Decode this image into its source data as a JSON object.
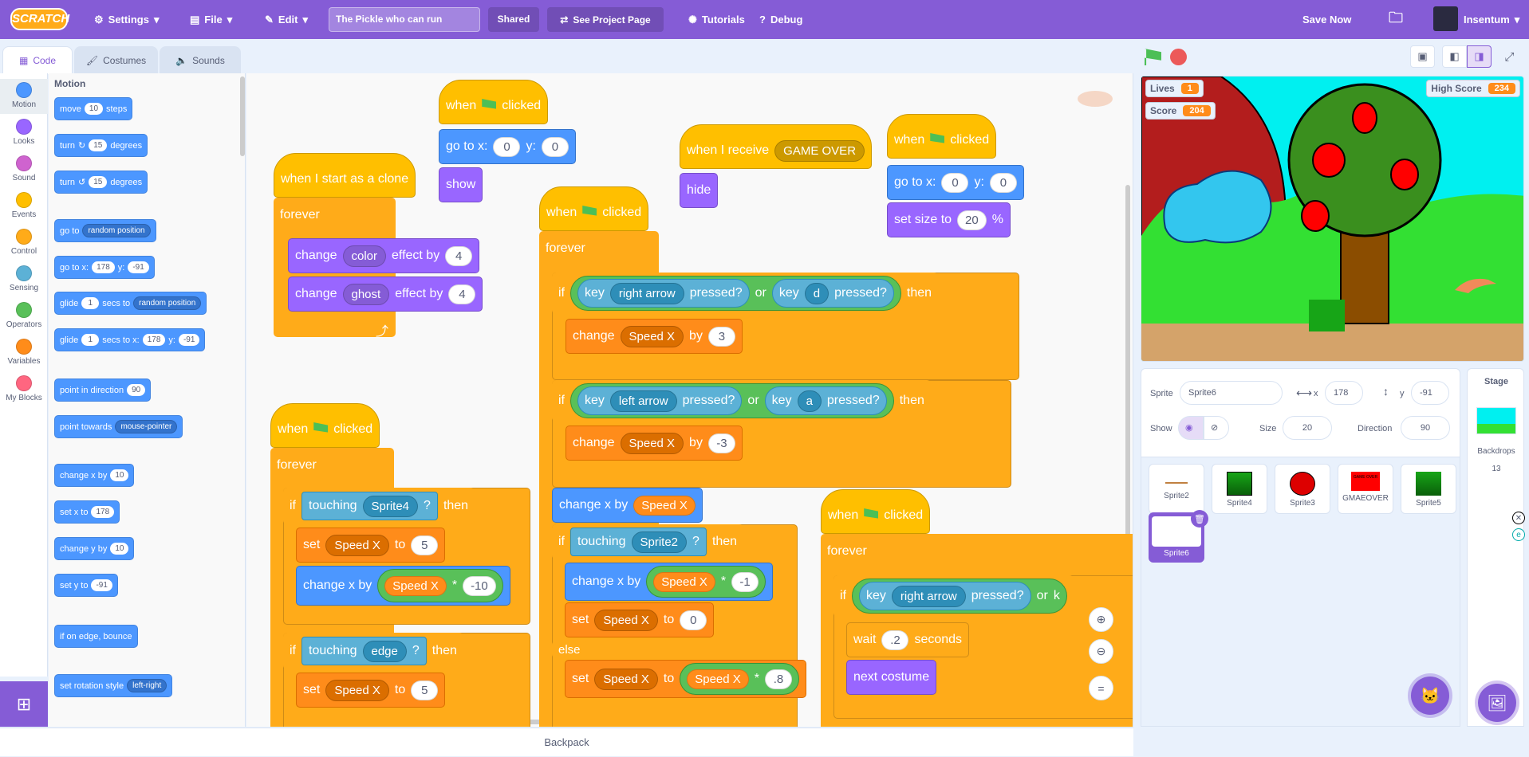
{
  "menubar": {
    "logo": "SCRATCH",
    "settings": "Settings",
    "file": "File",
    "edit": "Edit",
    "project_title": "The Pickle who can run",
    "shared": "Shared",
    "see_project_page": "See Project Page",
    "tutorials": "Tutorials",
    "debug": "Debug",
    "save_now": "Save Now",
    "username": "Insentum"
  },
  "tabs": {
    "code": "Code",
    "costumes": "Costumes",
    "sounds": "Sounds"
  },
  "categories": [
    {
      "label": "Motion",
      "color": "#4c97ff"
    },
    {
      "label": "Looks",
      "color": "#9966ff"
    },
    {
      "label": "Sound",
      "color": "#cf63cf"
    },
    {
      "label": "Events",
      "color": "#ffbf00"
    },
    {
      "label": "Control",
      "color": "#ffab19"
    },
    {
      "label": "Sensing",
      "color": "#5cb1d6"
    },
    {
      "label": "Operators",
      "color": "#59c059"
    },
    {
      "label": "Variables",
      "color": "#ff8c1a"
    },
    {
      "label": "My Blocks",
      "color": "#ff6680"
    }
  ],
  "palette": {
    "heading": "Motion",
    "move": {
      "a": "move",
      "n": "10",
      "b": "steps"
    },
    "turn_right": {
      "a": "turn",
      "n": "15",
      "b": "degrees"
    },
    "turn_left": {
      "a": "turn",
      "n": "15",
      "b": "degrees"
    },
    "goto": {
      "a": "go to",
      "dd": "random position"
    },
    "goto_xy": {
      "a": "go to x:",
      "x": "178",
      "b": "y:",
      "y": "-91"
    },
    "glide": {
      "a": "glide",
      "n": "1",
      "b": "secs to",
      "dd": "random position"
    },
    "glide_xy": {
      "a": "glide",
      "n": "1",
      "b": "secs to x:",
      "x": "178",
      "c": "y:",
      "y": "-91"
    },
    "point_dir": {
      "a": "point in direction",
      "n": "90"
    },
    "point_towards": {
      "a": "point towards",
      "dd": "mouse-pointer"
    },
    "change_x": {
      "a": "change x by",
      "n": "10"
    },
    "set_x": {
      "a": "set x to",
      "n": "178"
    },
    "change_y": {
      "a": "change y by",
      "n": "10"
    },
    "set_y": {
      "a": "set y to",
      "n": "-91"
    },
    "bounce": {
      "a": "if on edge, bounce"
    },
    "rot_style": {
      "a": "set rotation style",
      "dd": "left-right"
    }
  },
  "script1": {
    "hat": "when I start as a clone",
    "forever": "forever",
    "change": "change",
    "color": "color",
    "effect_by": "effect by",
    "v1": "4",
    "ghost": "ghost",
    "v2": "4"
  },
  "script2": {
    "when": "when",
    "clicked": "clicked",
    "goto": "go to x:",
    "x": "0",
    "y_lbl": "y:",
    "y": "0",
    "show": "show"
  },
  "script3": {
    "hat": "when I receive",
    "msg": "GAME OVER",
    "hide": "hide"
  },
  "script4": {
    "when": "when",
    "clicked": "clicked",
    "goto": "go to x:",
    "x": "0",
    "y_lbl": "y:",
    "y": "0",
    "set_size": "set size to",
    "size": "20",
    "pct": "%"
  },
  "script5": {
    "when": "when",
    "clicked": "clicked",
    "forever": "forever",
    "if": "if",
    "then": "then",
    "key": "key",
    "pressed": "pressed?",
    "or": "or",
    "right_arrow": "right arrow",
    "d": "d",
    "left_arrow": "left arrow",
    "a": "a",
    "change": "change",
    "speedx": "Speed X",
    "by": "by",
    "v3": "3",
    "vm3": "-3",
    "change_x_by": "change x by",
    "touching": "touching",
    "sprite2": "Sprite2",
    "q": "?",
    "m1": "-1",
    "star": "*",
    "set": "set",
    "to": "to",
    "zero": "0",
    "else": "else",
    "p8": ".8"
  },
  "script6": {
    "when": "when",
    "clicked": "clicked",
    "forever": "forever",
    "if": "if",
    "then": "then",
    "touching": "touching",
    "sprite4": "Sprite4",
    "q": "?",
    "set": "set",
    "speedx": "Speed X",
    "to": "to",
    "five": "5",
    "change_x_by": "change x by",
    "star": "*",
    "m10": "-10",
    "edge": "edge",
    "five2": "5"
  },
  "script7": {
    "when": "when",
    "clicked": "clicked",
    "forever": "forever",
    "if": "if",
    "key": "key",
    "right_arrow": "right arrow",
    "pressed": "pressed?",
    "or": "or",
    "k": "k",
    "wait": "wait",
    "secs": ".2",
    "seconds": "seconds",
    "next_costume": "next costume"
  },
  "backpack": "Backpack",
  "monitors": {
    "lives_label": "Lives",
    "lives": "1",
    "score_label": "Score",
    "score": "204",
    "high_label": "High Score",
    "high": "234"
  },
  "sprite_info": {
    "sprite_label": "Sprite",
    "sprite_name": "Sprite6",
    "x_label": "x",
    "x": "178",
    "y_label": "y",
    "y": "-91",
    "show_label": "Show",
    "size_label": "Size",
    "size": "20",
    "direction_label": "Direction",
    "direction": "90"
  },
  "sprites": [
    "Sprite2",
    "Sprite4",
    "Sprite3",
    "GMAEOVER",
    "Sprite5",
    "Sprite6"
  ],
  "gameover_thumb_text": "GAME OVER",
  "stage_pane": {
    "title": "Stage",
    "backdrops_label": "Backdrops",
    "backdrops_count": "13"
  }
}
